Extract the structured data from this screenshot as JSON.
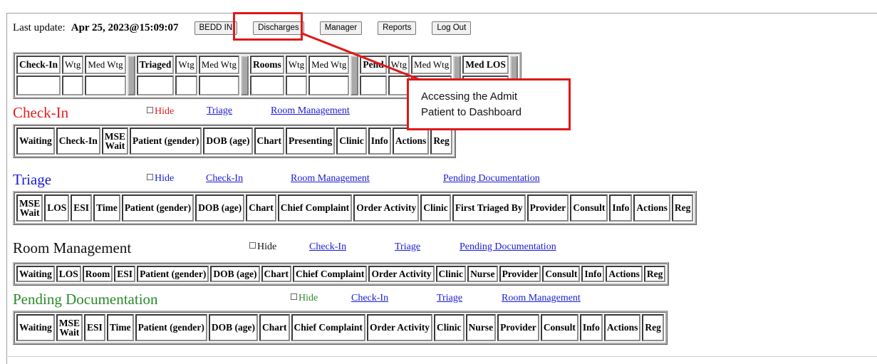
{
  "topbar": {
    "last_update_label": "Last update:",
    "last_update_value": "Apr 25, 2023@15:09:07",
    "buttons": [
      "BEDD IN",
      "Discharges",
      "Manager",
      "Reports",
      "Log Out"
    ]
  },
  "summary": {
    "headers": [
      "Check-In",
      "Wtg",
      "Med Wtg",
      "Triaged",
      "Wtg",
      "Med Wtg",
      "Rooms",
      "Wtg",
      "Med Wtg",
      "Pend",
      "Wtg",
      "Med Wtg",
      "Med LOS"
    ]
  },
  "checkin": {
    "title": "Check-In",
    "hide_label": "Hide",
    "links": [
      "Triage",
      "Room Management"
    ],
    "columns": [
      "Waiting",
      "Check-In",
      "MSE",
      "Wait",
      "Patient (gender)",
      "DOB (age)",
      "Chart",
      "Presenting",
      "Clinic",
      "Info",
      "Actions",
      "Reg"
    ]
  },
  "triage": {
    "title": "Triage",
    "hide_label": "Hide",
    "links": [
      "Check-In",
      "Room Management",
      "Pending Documentation"
    ],
    "columns": [
      "MSE",
      "Wait",
      "LOS",
      "ESI",
      "Time",
      "Patient (gender)",
      "DOB (age)",
      "Chart",
      "Chief Complaint",
      "Order Activity",
      "Clinic",
      "First Triaged By",
      "Provider",
      "Consult",
      "Info",
      "Actions",
      "Reg"
    ]
  },
  "room": {
    "title": "Room Management",
    "hide_label": "Hide",
    "links": [
      "Check-In",
      "Triage",
      "Pending Documentation"
    ],
    "columns": [
      "Waiting",
      "LOS",
      "Room",
      "ESI",
      "Patient (gender)",
      "DOB (age)",
      "Chart",
      "Chief Complaint",
      "Order Activity",
      "Clinic",
      "Nurse",
      "Provider",
      "Consult",
      "Info",
      "Actions",
      "Reg"
    ]
  },
  "pending": {
    "title": "Pending Documentation",
    "hide_label": "Hide",
    "links": [
      "Check-In",
      "Triage",
      "Room Management"
    ],
    "columns": [
      "Waiting",
      "MSE",
      "Wait",
      "ESI",
      "Time",
      "Patient (gender)",
      "DOB (age)",
      "Chart",
      "Chief Complaint",
      "Order Activity",
      "Clinic",
      "Nurse",
      "Provider",
      "Consult",
      "Info",
      "Actions",
      "Reg"
    ]
  },
  "callout": {
    "line1": "Accessing the Admit",
    "line2": "Patient to Dashboard"
  },
  "colors": {
    "checkin_title": "#e81a1a",
    "triage_title": "#1a1ad4",
    "room_title": "#111111",
    "pending_title": "#2a8a2a",
    "link": "#1a1ad4",
    "callout_border": "#e01818"
  }
}
